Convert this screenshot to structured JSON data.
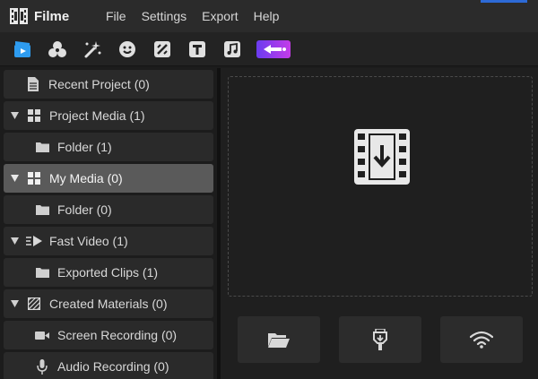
{
  "app": {
    "name": "Filme"
  },
  "menu": {
    "items": [
      "File",
      "Settings",
      "Export",
      "Help"
    ]
  },
  "toolbar": {
    "tools": [
      "media-icon",
      "effects-icon",
      "magic-icon",
      "sticker-icon",
      "transition-icon",
      "text-icon",
      "music-icon",
      "premium-icon"
    ],
    "accent": "#2e9cf0"
  },
  "sidebar": {
    "items": [
      {
        "label": "Recent Project (0)",
        "icon": "document-icon"
      },
      {
        "label": "Project Media (1)",
        "icon": "grid-icon"
      },
      {
        "label": "Folder (1)",
        "icon": "folder-icon"
      },
      {
        "label": "My Media (0)",
        "icon": "grid-icon",
        "selected": true
      },
      {
        "label": "Folder (0)",
        "icon": "folder-icon"
      },
      {
        "label": "Fast Video (1)",
        "icon": "fast-forward-icon"
      },
      {
        "label": "Exported Clips (1)",
        "icon": "folder-icon"
      },
      {
        "label": "Created Materials (0)",
        "icon": "materials-icon"
      },
      {
        "label": "Screen Recording (0)",
        "icon": "camera-icon"
      },
      {
        "label": "Audio Recording (0)",
        "icon": "microphone-icon"
      }
    ],
    "selected_color": "#5a5a5a"
  },
  "main": {
    "dropzone_icon": "import-film-icon",
    "buttons": [
      "open-folder-icon",
      "usb-device-icon",
      "wifi-icon"
    ]
  }
}
